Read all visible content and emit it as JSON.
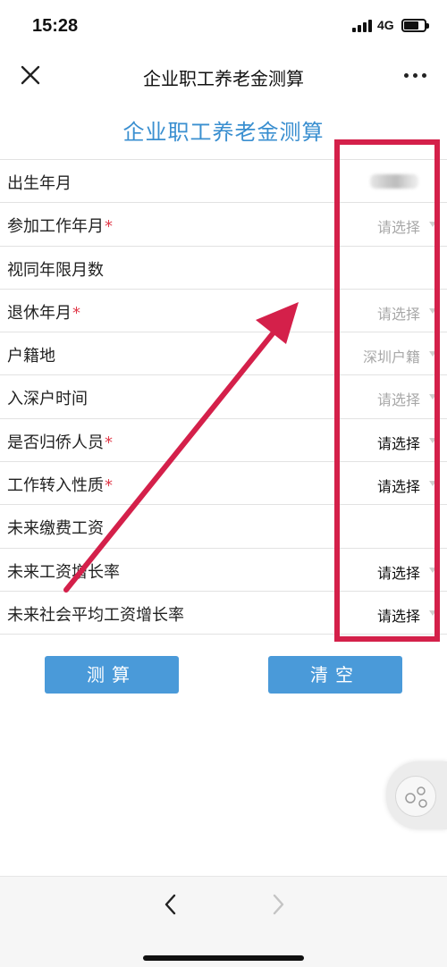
{
  "status_bar": {
    "time": "15:28",
    "network": "4G"
  },
  "nav": {
    "title": "企业职工养老金测算",
    "close_icon": "close-icon",
    "more_icon": "more-icon"
  },
  "page": {
    "title": "企业职工养老金测算"
  },
  "form": {
    "rows": [
      {
        "label": "出生年月",
        "required": "",
        "value": "",
        "value_style": "blurred"
      },
      {
        "label": "参加工作年月",
        "required": "*",
        "value": "请选择",
        "value_style": "placeholder"
      },
      {
        "label": "视同年限月数",
        "required": "",
        "value": "",
        "value_style": "empty"
      },
      {
        "label": "退休年月",
        "required": "*",
        "value": "请选择",
        "value_style": "placeholder"
      },
      {
        "label": "户籍地",
        "required": "",
        "value": "深圳户籍",
        "value_style": "placeholder"
      },
      {
        "label": "入深户时间",
        "required": "",
        "value": "请选择",
        "value_style": "placeholder"
      },
      {
        "label": "是否归侨人员",
        "required": "*",
        "value": "请选择",
        "value_style": "dark"
      },
      {
        "label": "工作转入性质",
        "required": "*",
        "value": "请选择",
        "value_style": "dark"
      },
      {
        "label": "未来缴费工资",
        "required": "",
        "value": "",
        "value_style": "empty"
      },
      {
        "label": "未来工资增长率",
        "required": "",
        "value": "请选择",
        "value_style": "dark"
      },
      {
        "label": "未来社会平均工资增长率",
        "required": "",
        "value": "请选择",
        "value_style": "dark"
      }
    ]
  },
  "buttons": {
    "calculate": "测算",
    "clear": "清空"
  },
  "colors": {
    "accent": "#4a9ad9",
    "title_blue": "#3a8fd0",
    "highlight": "#d4204a",
    "required": "#e03a4a"
  },
  "bottom_bar": {
    "back_icon": "chevron-left-icon",
    "forward_icon": "chevron-right-icon"
  }
}
